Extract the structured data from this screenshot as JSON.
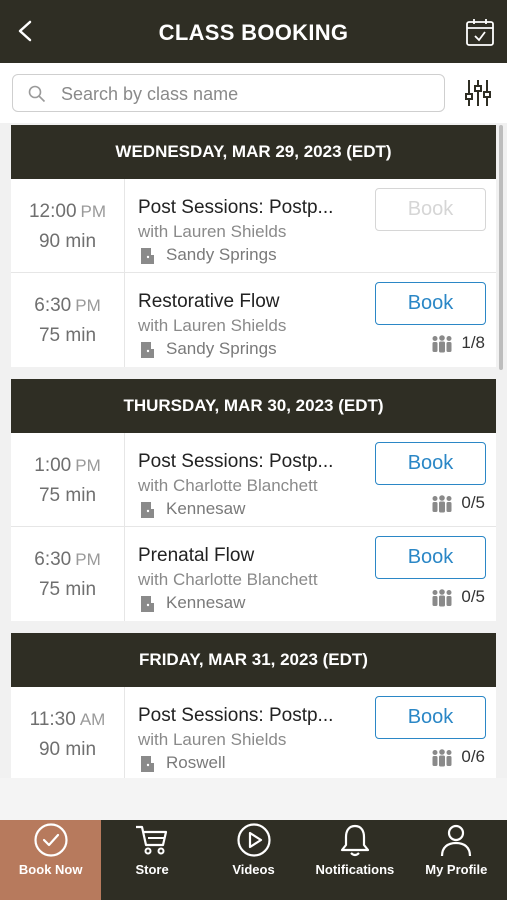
{
  "header": {
    "title": "CLASS BOOKING"
  },
  "search": {
    "placeholder": "Search by class name"
  },
  "days": [
    {
      "label": "WEDNESDAY, MAR 29, 2023 (EDT)",
      "classes": [
        {
          "time": "12:00",
          "ampm": "PM",
          "duration": "90 min",
          "name": "Post Sessions: Postp...",
          "instructor": "with Lauren Shields",
          "location": "Sandy Springs",
          "book_label": "Book",
          "book_enabled": false,
          "capacity": ""
        },
        {
          "time": "6:30",
          "ampm": "PM",
          "duration": "75 min",
          "name": "Restorative Flow",
          "instructor": "with Lauren Shields",
          "location": "Sandy Springs",
          "book_label": "Book",
          "book_enabled": true,
          "capacity": "1/8"
        }
      ]
    },
    {
      "label": "THURSDAY, MAR 30, 2023 (EDT)",
      "classes": [
        {
          "time": "1:00",
          "ampm": "PM",
          "duration": "75 min",
          "name": "Post Sessions: Postp...",
          "instructor": "with Charlotte Blanchett",
          "location": "Kennesaw",
          "book_label": "Book",
          "book_enabled": true,
          "capacity": "0/5"
        },
        {
          "time": "6:30",
          "ampm": "PM",
          "duration": "75 min",
          "name": "Prenatal Flow",
          "instructor": "with Charlotte Blanchett",
          "location": "Kennesaw",
          "book_label": "Book",
          "book_enabled": true,
          "capacity": "0/5"
        }
      ]
    },
    {
      "label": "FRIDAY, MAR 31, 2023 (EDT)",
      "classes": [
        {
          "time": "11:30",
          "ampm": "AM",
          "duration": "90 min",
          "name": "Post Sessions: Postp...",
          "instructor": "with Lauren Shields",
          "location": "Roswell",
          "book_label": "Book",
          "book_enabled": true,
          "capacity": "0/6"
        }
      ]
    }
  ],
  "tabs": [
    {
      "label": "Book Now",
      "icon": "check-circle-icon",
      "active": true
    },
    {
      "label": "Store",
      "icon": "cart-icon",
      "active": false
    },
    {
      "label": "Videos",
      "icon": "play-circle-icon",
      "active": false
    },
    {
      "label": "Notifications",
      "icon": "bell-icon",
      "active": false
    },
    {
      "label": "My Profile",
      "icon": "user-icon",
      "active": false
    }
  ],
  "colors": {
    "header_bg": "#2f2e24",
    "accent_blue": "#2b87c6",
    "active_tab": "#b77a5d"
  }
}
